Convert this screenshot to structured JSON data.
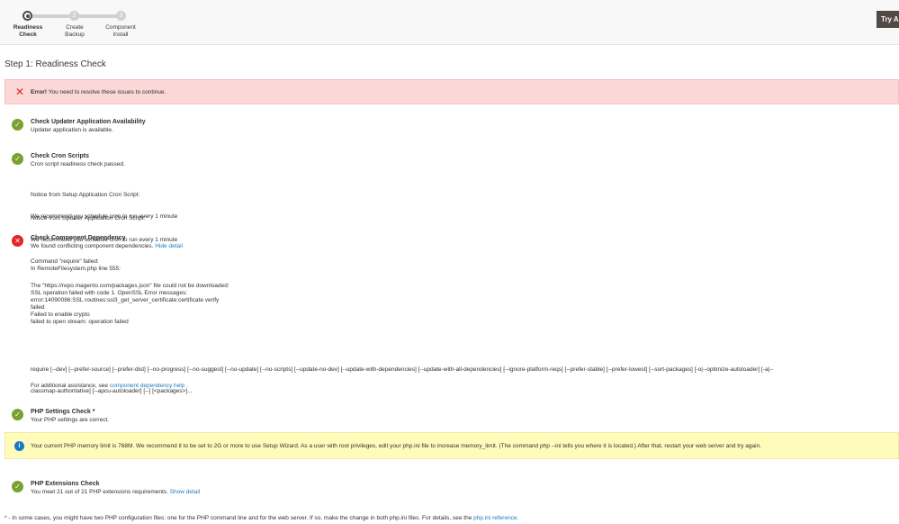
{
  "progress": {
    "steps": [
      {
        "number": "1",
        "label_line1": "Readiness",
        "label_line2": "Check"
      },
      {
        "number": "2",
        "label_line1": "Create",
        "label_line2": "Backup"
      },
      {
        "number": "3",
        "label_line1": "Component",
        "label_line2": "Install"
      }
    ],
    "try_button": "Try A"
  },
  "page_title": "Step 1: Readiness Check",
  "error": {
    "icon": "close-x-icon",
    "strong": "Error!",
    "message": " You need to resolve these issues to continue."
  },
  "checks": {
    "updater": {
      "title": "Check Updater Application Availability",
      "status": "Updater application is available."
    },
    "cron": {
      "title": "Check Cron Scripts",
      "status": "Cron script readiness check passed.",
      "notice1_line1": "Notice from Setup Application Cron Script:",
      "notice1_line2": "We recommend you schedule cron to run every 1 minute",
      "notice2_line1": "Notice from Updater Application Cron Script:",
      "notice2_line2": "We recommend you schedule cron to run every 1 minute"
    },
    "dependency": {
      "title": "Check Component Dependency",
      "status": "We found conflicting component dependencies.",
      "toggle_link": "Hide detail",
      "detail_head": "Command \"require\" failed:\nIn RemoteFilesystem.php line 555:",
      "detail_body": "The \"https://repo.magento.com/packages.json\" file could not be downloaded:\nSSL operation failed with code 1. OpenSSL Error messages:\nerror:14090086:SSL routines:ssl3_get_server_certificate:certificate verify\nfailed\nFailed to enable crypto\nfailed to open stream: operation failed",
      "usage_line1": "require [--dev] [--prefer-source] [--prefer-dist] [--no-progress] [--no-suggest] [--no-update] [--no-scripts] [--update-no-dev] [--update-with-dependencies] [--update-with-all-dependencies] [--ignore-platform-reqs] [--prefer-stable] [--prefer-lowest] [--sort-packages] [-o|--optimize-autoloader] [-a|--",
      "usage_line2": "classmap-authoritative] [--apcu-autoloader] [--] [<packages>]...",
      "help_prefix": "For additional assistance, see ",
      "help_link": "component dependency help",
      "help_suffix": " ."
    },
    "php_settings": {
      "title": "PHP Settings Check *",
      "status": "Your PHP settings are correct."
    },
    "php_extensions": {
      "title": "PHP Extensions Check",
      "status": "You meet 21 out of 21 PHP extensions requirements.",
      "toggle_link": "Show detail"
    }
  },
  "memory_notice": "Your current PHP memory limit is 768M. We recommend it to be set to 2G or more to use Setup Wizard. As a user with root privileges, edit your php.ini file to increase memory_limit. (The command php --ini tells you where it is located.) After that, restart your web server and try again.",
  "footnote": {
    "text": "* - In some cases, you might have two PHP configuration files: one for the PHP command line and for the web server. If so, make the change in both php.ini files. For details, see the ",
    "link": "php.ini reference",
    "suffix": "."
  },
  "colors": {
    "success": "#79a22e",
    "error": "#e22626",
    "link": "#1979c3",
    "error_bg": "#fbd7d7",
    "notice_bg": "#fffbbb",
    "dark_button": "#514943"
  }
}
